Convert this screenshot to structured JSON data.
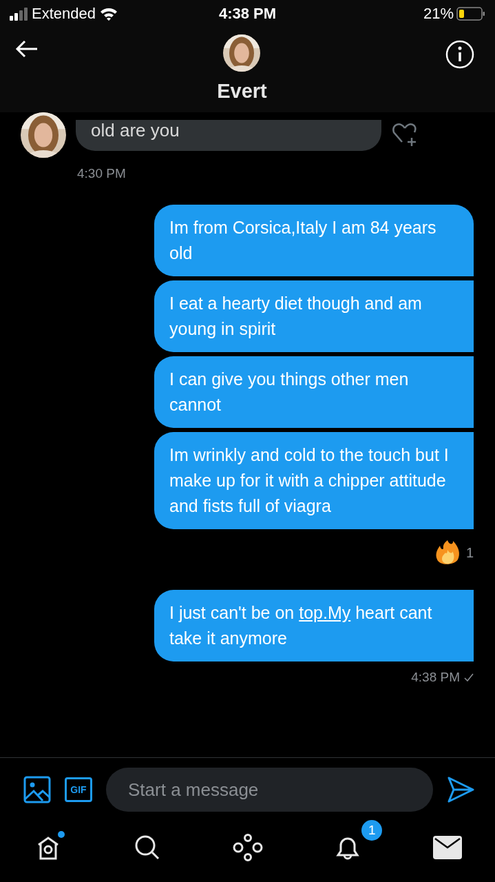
{
  "status_bar": {
    "carrier": "Extended",
    "time": "4:38 PM",
    "battery": "21%"
  },
  "header": {
    "name": "Evert"
  },
  "messages": [
    {
      "kind": "received",
      "parts": [
        {
          "text": "old are you"
        }
      ],
      "time": "4:30 PM"
    },
    {
      "kind": "sent",
      "parts": [
        {
          "text": "Im from Corsica,Italy I am 84 years old"
        }
      ]
    },
    {
      "kind": "sent",
      "parts": [
        {
          "text": "I eat a hearty diet though and am young in spirit"
        }
      ]
    },
    {
      "kind": "sent",
      "parts": [
        {
          "text": "I can give you things other men cannot"
        }
      ]
    },
    {
      "kind": "sent",
      "parts": [
        {
          "text": "Im wrinkly and cold to the touch but I make up for it with a chipper attitude and fists full of viagra"
        }
      ],
      "reaction_count": "1"
    },
    {
      "kind": "sent",
      "parts": [
        {
          "text": "I just can't be on "
        },
        {
          "text": "top.My",
          "link": true
        },
        {
          "text": " heart cant take it anymore"
        }
      ],
      "time": "4:38 PM",
      "seen": true
    }
  ],
  "composer": {
    "gif_label": "GIF",
    "placeholder": "Start a message"
  },
  "nav": [
    {
      "kind": "home",
      "dot": true
    },
    {
      "kind": "search"
    },
    {
      "kind": "spaces"
    },
    {
      "kind": "notifications",
      "badge": "1"
    },
    {
      "kind": "messages",
      "selected": true
    }
  ]
}
